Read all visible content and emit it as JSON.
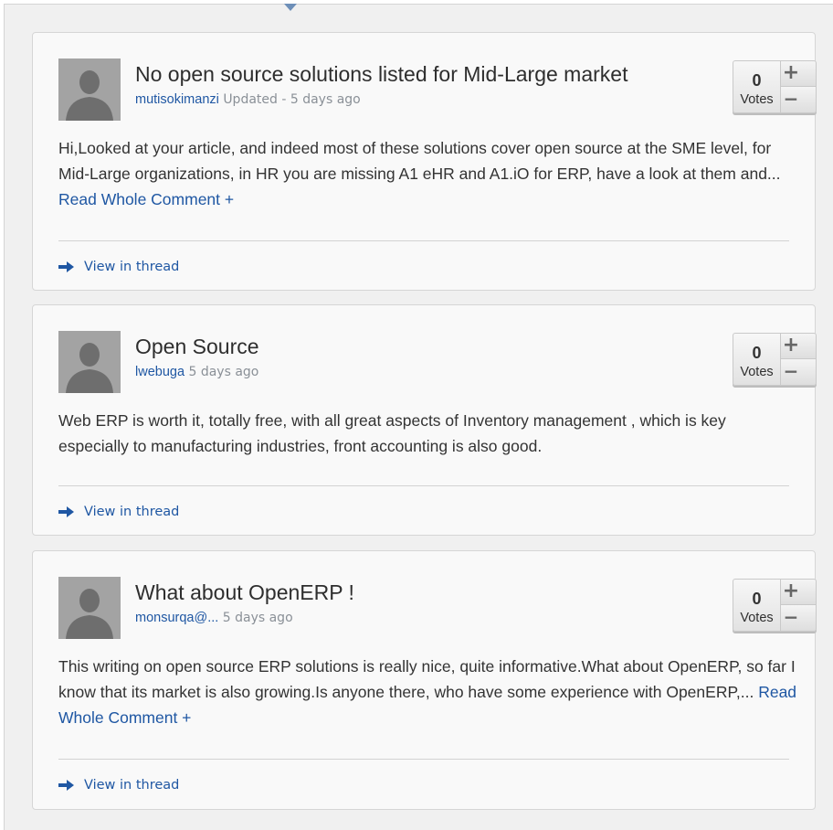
{
  "comments": [
    {
      "title": "No open source solutions listed for Mid-Large market",
      "author": "mutisokimanzi",
      "timestamp": "Updated - 5 days ago",
      "votes": {
        "count": "0",
        "label": "Votes"
      },
      "body": "Hi,Looked at your article, and indeed most of these solutions cover open source at the SME level, for Mid-Large organizations, in HR you are missing A1 eHR and A1.iO for ERP, have a look at them and...",
      "read_more": "Read Whole Comment +",
      "thread_link": "View in thread"
    },
    {
      "title": "Open Source",
      "author": "lwebuga",
      "timestamp": "5 days ago",
      "votes": {
        "count": "0",
        "label": "Votes"
      },
      "body": "Web ERP is worth it, totally free, with all great aspects of Inventory management , which is key especially to manufacturing industries, front accounting is also good.",
      "read_more": "",
      "thread_link": "View in thread"
    },
    {
      "title": "What about OpenERP !",
      "author": "monsurqa@...",
      "timestamp": "5 days ago",
      "votes": {
        "count": "0",
        "label": "Votes"
      },
      "body": "This writing on open source ERP solutions is really nice, quite informative.What about OpenERP, so far I know that its market is also growing.Is anyone there, who have some experience with OpenERP,...",
      "read_more": "Read Whole Comment +",
      "thread_link": "View in thread"
    }
  ],
  "icons": {
    "avatar": "user-silhouette-icon",
    "thread": "arrow-right-icon",
    "upvote": "plus-icon",
    "downvote": "minus-icon"
  },
  "colors": {
    "link": "#1f57a3",
    "meta": "#8a9097",
    "panel_bg": "#f0f0f0",
    "card_bg": "#f9f9f9",
    "arrow": "#1f57a3"
  }
}
